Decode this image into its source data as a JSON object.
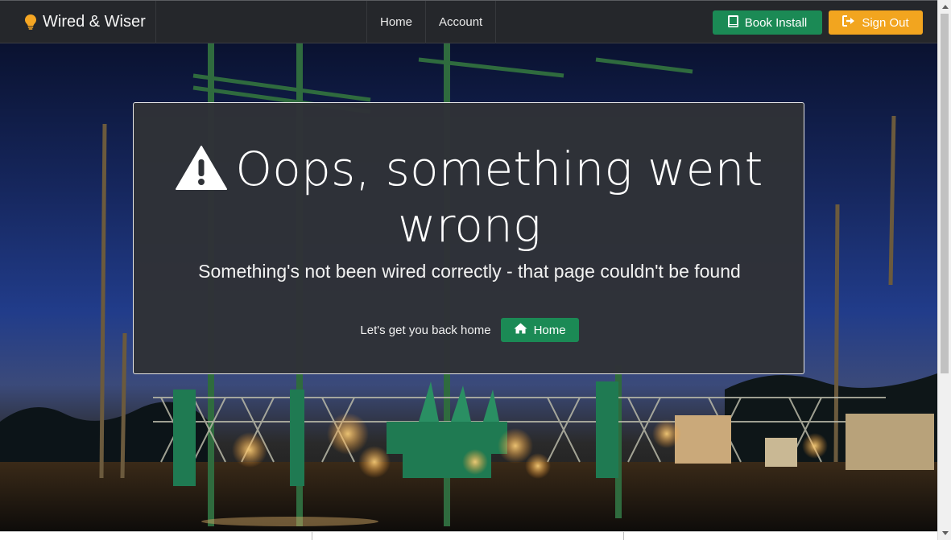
{
  "brand": {
    "name": "Wired & Wiser",
    "icon": "lightbulb-icon"
  },
  "nav": {
    "items": [
      {
        "label": "Home"
      },
      {
        "label": "Account"
      }
    ]
  },
  "actions": {
    "book_install": {
      "label": "Book Install",
      "icon": "book-icon"
    },
    "sign_out": {
      "label": "Sign Out",
      "icon": "sign-out-icon"
    }
  },
  "error": {
    "title": "Oops, something went wrong",
    "icon": "warning-icon",
    "subtitle": "Something's not been wired correctly - that page couldn't be found",
    "cta_text": "Let's get you back home",
    "home_button": {
      "label": "Home",
      "icon": "home-icon"
    }
  },
  "colors": {
    "navbar": "#25272b",
    "primary_green": "#1b8a55",
    "accent_orange": "#f2a51f",
    "card_bg": "#2f3237"
  }
}
